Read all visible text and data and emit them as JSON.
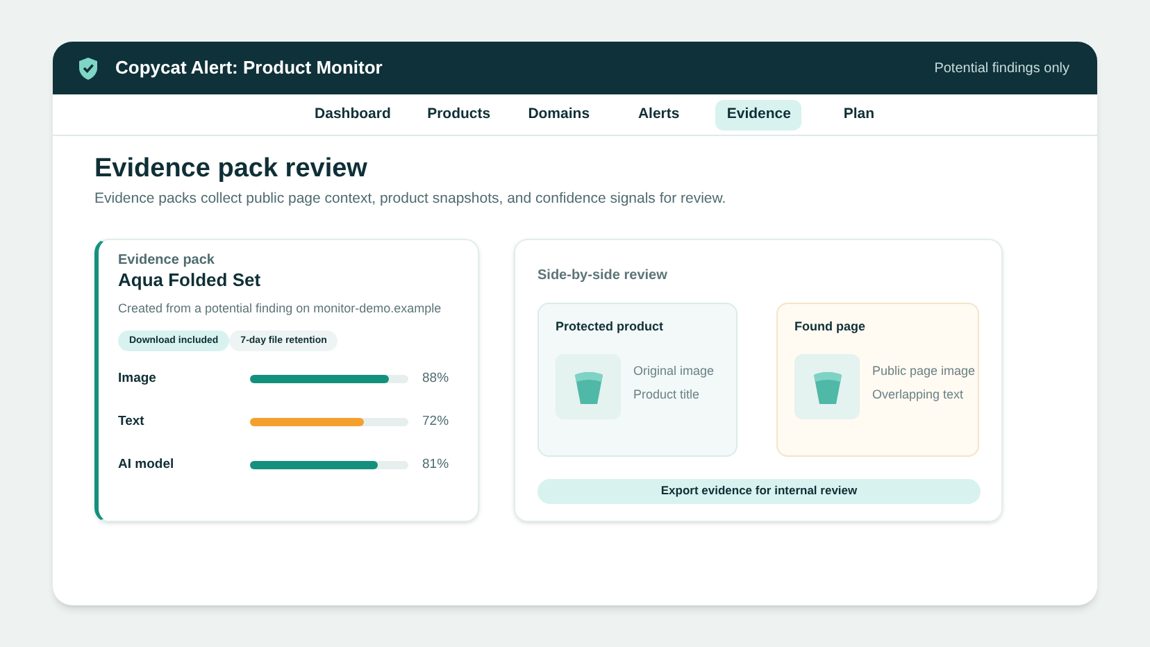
{
  "header": {
    "title": "Copycat Alert: Product Monitor",
    "note": "Potential findings only"
  },
  "nav": [
    {
      "label": "Dashboard",
      "selected": false
    },
    {
      "label": "Products",
      "selected": false
    },
    {
      "label": "Domains",
      "selected": false
    },
    {
      "label": "Alerts",
      "selected": false
    },
    {
      "label": "Evidence",
      "selected": true
    },
    {
      "label": "Plan",
      "selected": false
    }
  ],
  "page": {
    "title": "Evidence pack review",
    "subtitle": "Evidence packs collect public page context, product snapshots, and confidence signals for review."
  },
  "pack": {
    "eyebrow": "Evidence pack",
    "name": "Aqua Folded Set",
    "source": "Created from a potential finding on monitor-demo.example",
    "tags": [
      {
        "label": "Download included",
        "kind": "filled"
      },
      {
        "label": "7-day file retention",
        "kind": "muted"
      }
    ],
    "signals": [
      {
        "label": "Image",
        "level": 0.88,
        "reading": "88%",
        "color": "#14917c"
      },
      {
        "label": "Text",
        "level": 0.72,
        "reading": "72%",
        "color": "#f5a02c"
      },
      {
        "label": "AI model",
        "level": 0.81,
        "reading": "81%",
        "color": "#14917c"
      }
    ]
  },
  "review": {
    "title": "Side-by-side review",
    "panels": [
      {
        "kind": "reference",
        "title": "Protected product",
        "lines": [
          "Original image",
          "Product title"
        ]
      },
      {
        "kind": "match",
        "title": "Found page",
        "lines": [
          "Public page image",
          "Overlapping text"
        ]
      }
    ],
    "button": "Export evidence for internal review"
  }
}
